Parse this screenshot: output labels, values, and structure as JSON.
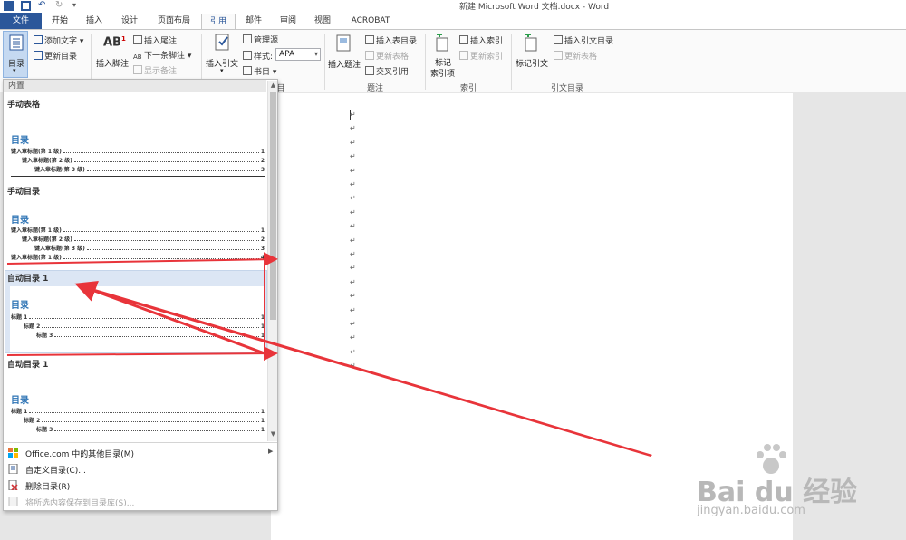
{
  "window": {
    "title": "新建 Microsoft Word 文档.docx - Word"
  },
  "tabs": [
    {
      "label": "文件"
    },
    {
      "label": "开始"
    },
    {
      "label": "插入"
    },
    {
      "label": "设计"
    },
    {
      "label": "页面布局"
    },
    {
      "label": "引用"
    },
    {
      "label": "邮件"
    },
    {
      "label": "审阅"
    },
    {
      "label": "视图"
    },
    {
      "label": "ACROBAT"
    }
  ],
  "ribbon": {
    "toc": {
      "button": "目录",
      "add_text": "添加文字",
      "update": "更新目录"
    },
    "footnotes": {
      "insert_footnote": "插入脚注",
      "insert_endnote": "插入尾注",
      "next_footnote": "下一条脚注",
      "show_notes": "显示备注"
    },
    "citations": {
      "insert_citation": "插入引文",
      "manage_sources": "管理源",
      "style_label": "样式:",
      "style_value": "APA",
      "bibliography": "书目",
      "group_partial": "目"
    },
    "captions": {
      "insert_caption": "插入题注",
      "insert_table_of_figures": "插入表目录",
      "update_table": "更新表格",
      "cross_reference": "交叉引用",
      "group": "题注"
    },
    "index": {
      "mark_entry": "标记\n索引项",
      "mark_entry_l1": "标记",
      "mark_entry_l2": "索引项",
      "insert_index": "插入索引",
      "update_index": "更新索引",
      "group": "索引"
    },
    "authorities": {
      "mark_citation": "标记引文",
      "insert_toa": "插入引文目录",
      "update_table": "更新表格",
      "group": "引文目录"
    }
  },
  "gallery": {
    "header": "内置",
    "items": [
      {
        "label": "手动表格",
        "toc_title": "目录",
        "lines": [
          "键入章标题(第 1 级)",
          "键入章标题(第 2 级)",
          "键入章标题(第 3 级)"
        ],
        "pages": [
          "1",
          "2",
          "3"
        ]
      },
      {
        "label": "手动目录",
        "toc_title": "目录",
        "lines": [
          "键入章标题(第 1 级)",
          "键入章标题(第 2 级)",
          "键入章标题(第 3 级)",
          "键入章标题(第 1 级)"
        ],
        "pages": [
          "1",
          "2",
          "3",
          "4"
        ]
      },
      {
        "label": "自动目录 1",
        "toc_title": "目录",
        "lines": [
          "标题 1",
          "标题 2",
          "标题 3"
        ],
        "pages": [
          "1",
          "1",
          "1"
        ]
      },
      {
        "label": "自动目录 1",
        "toc_title": "目录",
        "lines": [
          "标题 1",
          "标题 2",
          "标题 3"
        ],
        "pages": [
          "1",
          "1",
          "1"
        ]
      }
    ],
    "menu": [
      {
        "label": "Office.com 中的其他目录(M)",
        "disabled": false
      },
      {
        "label": "自定义目录(C)...",
        "disabled": false
      },
      {
        "label": "删除目录(R)",
        "disabled": false
      },
      {
        "label": "将所选内容保存到目录库(S)...",
        "disabled": true
      }
    ]
  },
  "paragraph_mark": "↵",
  "watermark": {
    "brand": "Bai du 经验",
    "url": "jingyan.baidu.com"
  },
  "colors": {
    "accent": "#2b579a",
    "annotation_arrow": "#e8343a",
    "toc_title": "#2e74b5",
    "selection": "#dce6f4"
  }
}
